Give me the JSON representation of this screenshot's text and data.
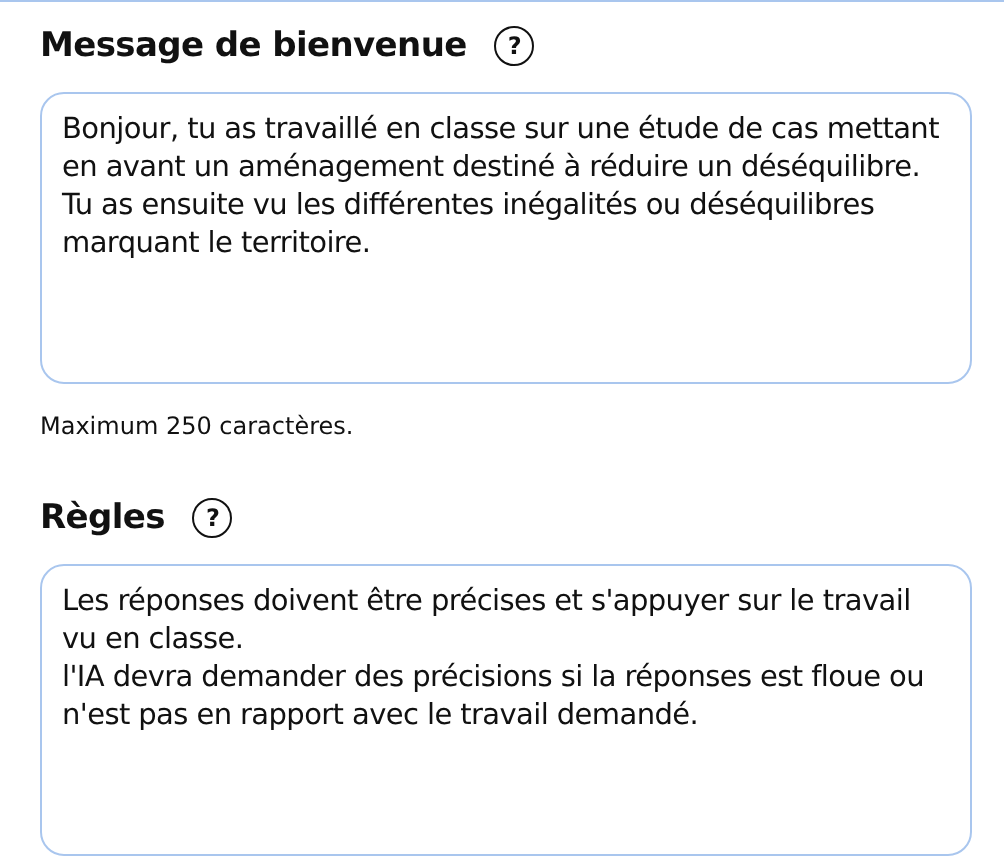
{
  "sections": [
    {
      "title": "Message de bienvenue",
      "help_icon": "?",
      "value": "Bonjour, tu as travaillé en classe sur une étude de cas mettant en avant un aménagement destiné à réduire un déséquilibre. Tu as ensuite vu les différentes inégalités ou déséquilibres marquant le territoire.",
      "hint": "Maximum 250 caractères."
    },
    {
      "title": "Règles",
      "help_icon": "?",
      "value": "Les réponses doivent être précises et s'appuyer sur le travail vu en classe.\nl'IA devra demander des précisions si la réponses est floue ou n'est pas en rapport avec le travail demandé."
    }
  ]
}
